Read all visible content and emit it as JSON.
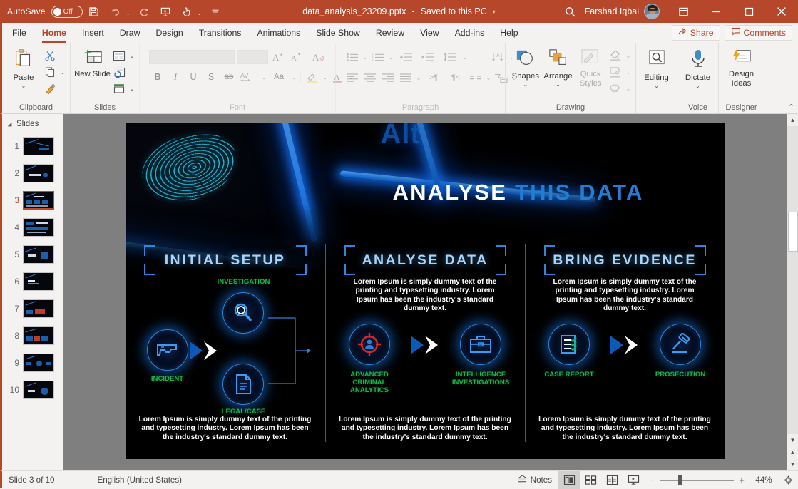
{
  "titlebar": {
    "autosave_label": "AutoSave",
    "autosave_state": "Off",
    "save_icon": "save-icon",
    "undo_icon": "undo-icon",
    "redo_icon": "redo-icon",
    "present_icon": "start-presentation-icon",
    "touch_icon": "touch-mode-icon",
    "customize_icon": "customize-quick-access-icon",
    "document_title": "data_analysis_23209.pptx",
    "save_status": "Saved to this PC",
    "search_icon": "search-icon",
    "user_name": "Farshad Iqbal",
    "avatar": "user-avatar",
    "ribbon_display_icon": "ribbon-display-options-icon",
    "minimize_icon": "minimize-icon",
    "restore_icon": "restore-icon",
    "close_icon": "close-icon",
    "accent_color": "#b7472a"
  },
  "ribbon": {
    "tabs": [
      {
        "label": "File",
        "active": false
      },
      {
        "label": "Home",
        "active": true
      },
      {
        "label": "Insert",
        "active": false
      },
      {
        "label": "Draw",
        "active": false
      },
      {
        "label": "Design",
        "active": false
      },
      {
        "label": "Transitions",
        "active": false
      },
      {
        "label": "Animations",
        "active": false
      },
      {
        "label": "Slide Show",
        "active": false
      },
      {
        "label": "Review",
        "active": false
      },
      {
        "label": "View",
        "active": false
      },
      {
        "label": "Add-ins",
        "active": false
      },
      {
        "label": "Help",
        "active": false
      }
    ],
    "share_label": "Share",
    "comments_label": "Comments",
    "groups": {
      "clipboard": {
        "label": "Clipboard",
        "paste_label": "Paste",
        "cut_icon": "scissors-icon",
        "copy_icon": "copy-icon",
        "format_painter_icon": "format-painter-icon"
      },
      "slides": {
        "label": "Slides",
        "new_slide_label": "New Slide",
        "layout_icon": "slide-layout-icon",
        "reset_icon": "reset-slide-icon",
        "section_icon": "section-icon"
      },
      "font": {
        "label": "Font",
        "font_name_value": "",
        "font_size_value": "",
        "grow_font_icon": "grow-font-icon",
        "shrink_font_icon": "shrink-font-icon",
        "clear_formatting_icon": "clear-formatting-icon",
        "bold_label": "B",
        "italic_label": "I",
        "underline_label": "U",
        "shadow_label": "S",
        "strikethrough_label": "ab",
        "character_spacing_label": "AV",
        "change_case_label": "Aa",
        "text_highlight_icon": "text-highlight-icon",
        "font_color_label": "A"
      },
      "paragraph": {
        "label": "Paragraph",
        "bullets_icon": "bullets-icon",
        "numbering_icon": "numbering-icon",
        "decrease_indent_icon": "decrease-indent-icon",
        "increase_indent_icon": "increase-indent-icon",
        "line_spacing_icon": "line-spacing-icon",
        "align_left_icon": "align-left-icon",
        "align_center_icon": "align-center-icon",
        "align_right_icon": "align-right-icon",
        "justify_icon": "justify-icon",
        "columns_icon": "columns-icon",
        "text_direction_icon": "text-direction-icon",
        "align_text_icon": "align-text-icon",
        "smartart_icon": "convert-to-smartart-icon"
      },
      "drawing": {
        "label": "Drawing",
        "shapes_label": "Shapes",
        "arrange_label": "Arrange",
        "quick_styles_label": "Quick Styles",
        "shape_fill_icon": "shape-fill-icon",
        "shape_outline_icon": "shape-outline-icon",
        "shape_effects_icon": "shape-effects-icon"
      },
      "editing": {
        "label": "",
        "editing_label": "Editing",
        "icon": "find-magnifier-icon"
      },
      "voice": {
        "label": "Voice",
        "dictate_label": "Dictate",
        "icon": "microphone-icon"
      },
      "designer": {
        "label": "Designer",
        "design_ideas_label": "Design Ideas",
        "icon": "design-ideas-icon"
      }
    }
  },
  "thumbnails": {
    "header": "Slides",
    "items": [
      {
        "number": "1",
        "selected": false
      },
      {
        "number": "2",
        "selected": false
      },
      {
        "number": "3",
        "selected": true
      },
      {
        "number": "4",
        "selected": false
      },
      {
        "number": "5",
        "selected": false
      },
      {
        "number": "6",
        "selected": false
      },
      {
        "number": "7",
        "selected": false
      },
      {
        "number": "8",
        "selected": false
      },
      {
        "number": "9",
        "selected": false
      },
      {
        "number": "10",
        "selected": false
      }
    ]
  },
  "slide": {
    "background": "fingerprint-on-backlit-keyboard-photo",
    "background_text": "Alt",
    "title_white": "ANALYSE",
    "title_blue": "THIS DATA",
    "lorem": "Lorem Ipsum is simply dummy text of the printing and typesetting industry. Lorem Ipsum has been the industry's standard dummy text.",
    "columns": [
      {
        "heading": "INITIAL SETUP",
        "top_paragraph": "",
        "bottom_paragraph": "Lorem Ipsum is simply dummy text of the printing and typesetting industry. Lorem Ipsum has been the industry's standard dummy text.",
        "nodes": [
          {
            "label": "INCIDENT",
            "icon": "gun-icon",
            "color": "#2e86e2"
          },
          {
            "label": "INVESTIGATION",
            "icon": "magnifier-icon",
            "color": "#2e86e2"
          },
          {
            "label": "LEGAL/CASE",
            "icon": "document-icon",
            "color": "#2e86e2"
          }
        ]
      },
      {
        "heading": "ANALYSE DATA",
        "top_paragraph": "Lorem Ipsum is simply dummy text of the printing and typesetting industry. Lorem Ipsum has been the industry's standard dummy text.",
        "bottom_paragraph": "Lorem Ipsum is simply dummy text of the printing and typesetting industry. Lorem Ipsum has been the industry's standard dummy text.",
        "nodes": [
          {
            "label": "ADVANCED CRIMINAL ANALYTICS",
            "icon": "target-crosshair-icon",
            "color": "#e02020"
          },
          {
            "label": "INTELLIGENCE INVESTIGATIONS",
            "icon": "briefcase-icon",
            "color": "#2e86e2"
          }
        ]
      },
      {
        "heading": "BRING EVIDENCE",
        "top_paragraph": "Lorem Ipsum is simply dummy text of the printing and typesetting industry. Lorem Ipsum has been the industry's standard dummy text.",
        "bottom_paragraph": "Lorem Ipsum is simply dummy text of the printing and typesetting industry. Lorem Ipsum has been the industry's standard dummy text.",
        "nodes": [
          {
            "label": "CASE REPORT",
            "icon": "checklist-icon",
            "color": "#2e86e2"
          },
          {
            "label": "PROSECUTION",
            "icon": "gavel-icon",
            "color": "#2e86e2"
          }
        ]
      }
    ],
    "colors": {
      "title_accent": "#1f7fd6",
      "heading": "#a8d4f7",
      "node_label": "#18b64a",
      "arrow": "#0a5bb8",
      "divider": "#1d64b5"
    }
  },
  "status": {
    "slide_counter": "Slide 3 of 10",
    "language": "English (United States)",
    "notes_label": "Notes",
    "notes_icon": "notes-icon",
    "views": [
      {
        "name": "normal-view",
        "icon": "normal-view-icon",
        "active": true
      },
      {
        "name": "slide-sorter-view",
        "icon": "slide-sorter-icon",
        "active": false
      },
      {
        "name": "reading-view",
        "icon": "reading-view-icon",
        "active": false
      },
      {
        "name": "slide-show-view",
        "icon": "slide-show-icon",
        "active": false
      }
    ],
    "zoom_out_label": "−",
    "zoom_in_label": "+",
    "zoom_level": "44%",
    "fit_icon": "fit-to-window-icon"
  }
}
